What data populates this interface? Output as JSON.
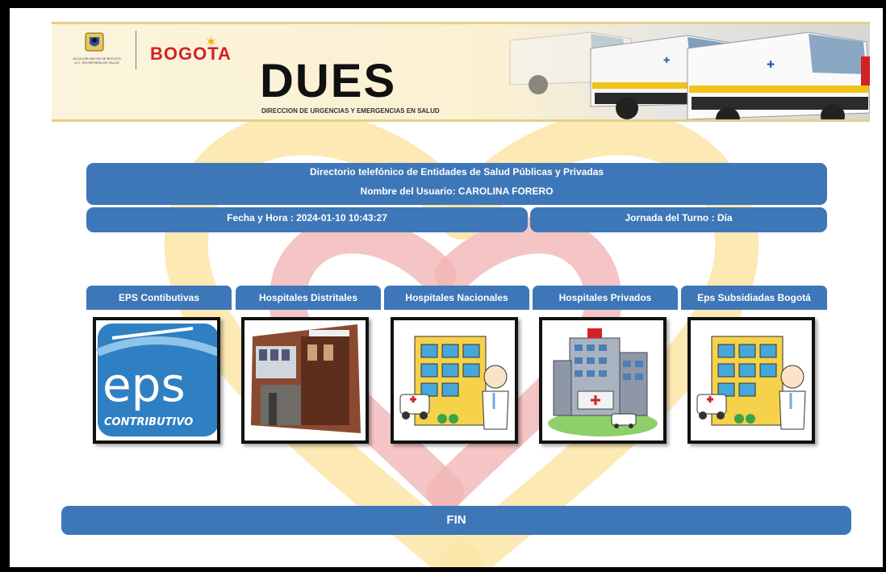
{
  "banner": {
    "alcaldia_text": "ALCALDÍA MAYOR DE BOGOTÁ D.C. SECRETARÍA DE SALUD",
    "bogota_logo": "BOGOTA",
    "title": "DUES",
    "subtitle": "DIRECCION DE URGENCIAS Y EMERGENCIAS EN SALUD"
  },
  "info": {
    "directory_title": "Directorio telefónico de Entidades de Salud Públicas y Privadas",
    "user_name": "Nombre del Usuario: CAROLINA FORERO",
    "datetime": "Fecha y Hora : 2024-01-10 10:43:27",
    "shift": "Jornada del Turno : Día"
  },
  "categories": [
    {
      "label": "EPS Contibutivas",
      "icon": "eps-contributivo-icon",
      "icon_text": "eps",
      "icon_subtext": "CONTRIBUTIVO"
    },
    {
      "label": "Hospitales Distritales",
      "icon": "district-hospital-photo"
    },
    {
      "label": "Hospitales Nacionales",
      "icon": "hospital-doctor-icon"
    },
    {
      "label": "Hospitales Privados",
      "icon": "private-hospital-icon"
    },
    {
      "label": "Eps Subsidiadas Bogotá",
      "icon": "hospital-doctor-icon"
    }
  ],
  "footer": {
    "fin_label": "FIN"
  },
  "colors": {
    "accent": "#3e77b8",
    "banner_red": "#d42124",
    "heart_yellow": "#fbe39a",
    "heart_red": "#f2b3b3"
  }
}
